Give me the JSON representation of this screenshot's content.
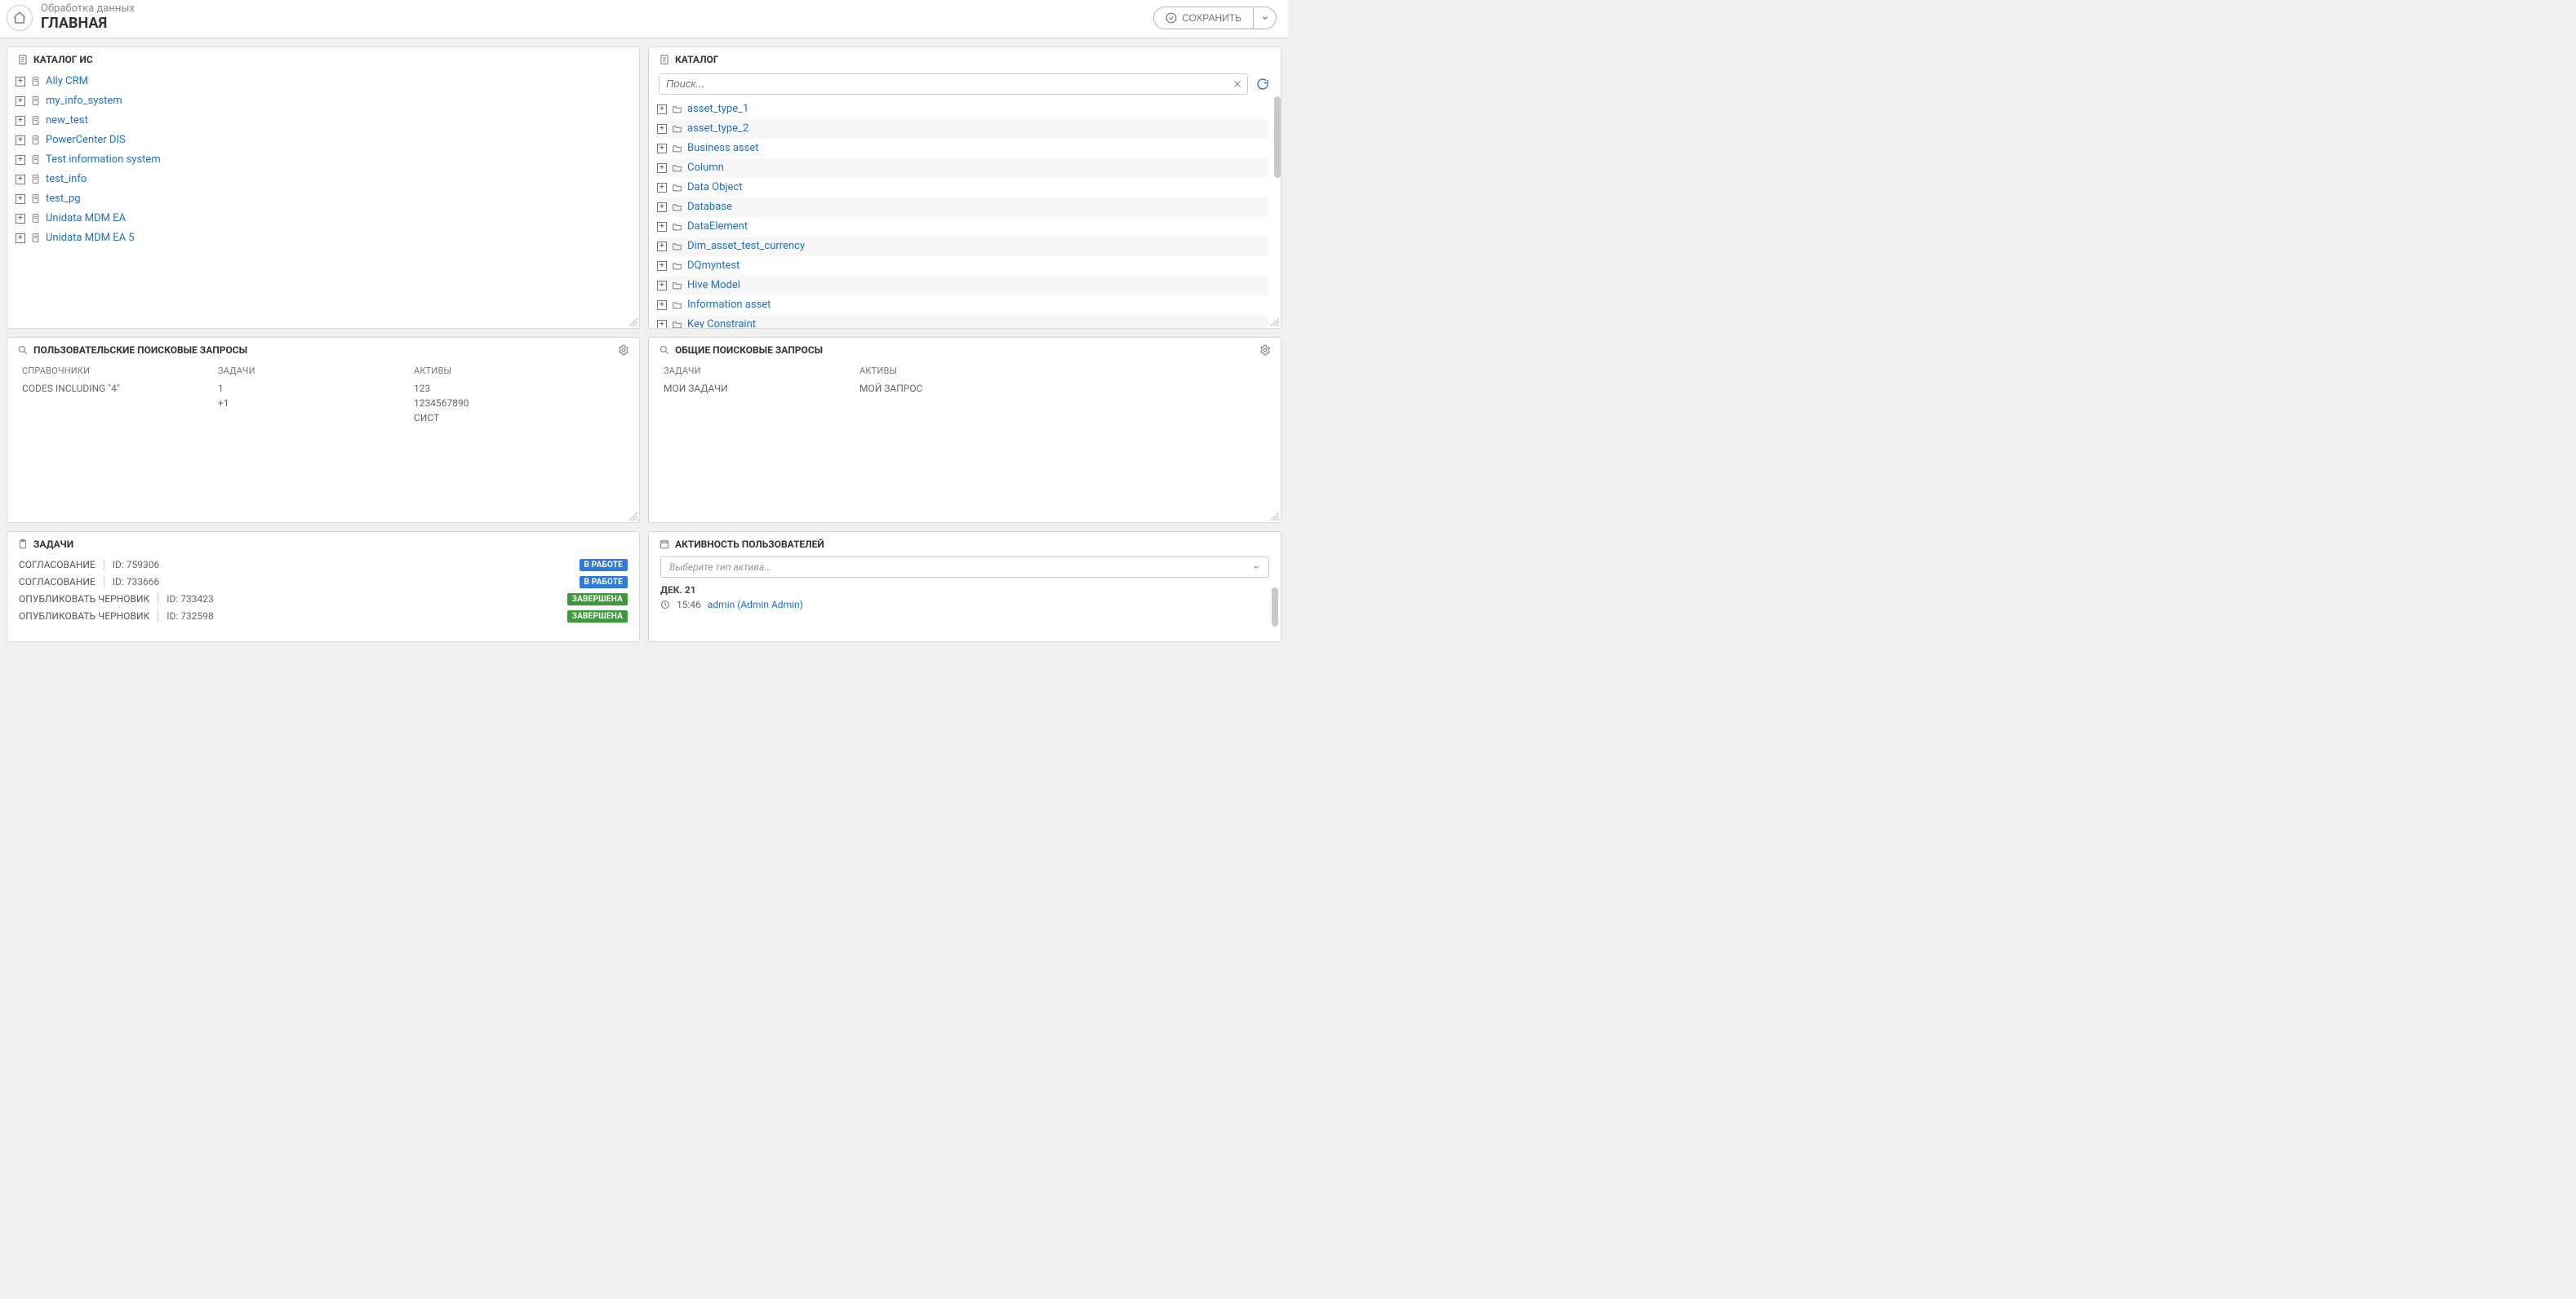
{
  "header": {
    "subtitle": "Обработка данных",
    "title": "ГЛАВНАЯ",
    "save_label": "СОХРАНИТЬ"
  },
  "catalog_is": {
    "title": "КАТАЛОГ ИС",
    "items": [
      {
        "label": "Ally CRM"
      },
      {
        "label": "my_info_system"
      },
      {
        "label": "new_test"
      },
      {
        "label": "PowerCenter DIS"
      },
      {
        "label": "Test information system"
      },
      {
        "label": "test_info"
      },
      {
        "label": "test_pg"
      },
      {
        "label": "Unidata MDM EA"
      },
      {
        "label": "Unidata MDM EA 5"
      }
    ]
  },
  "catalog": {
    "title": "КАТАЛОГ",
    "search_placeholder": "Поиск...",
    "items": [
      {
        "label": "asset_type_1"
      },
      {
        "label": "asset_type_2"
      },
      {
        "label": "Business asset"
      },
      {
        "label": "Column"
      },
      {
        "label": "Data Object"
      },
      {
        "label": "Database"
      },
      {
        "label": "DataElement"
      },
      {
        "label": "Dim_asset_test_currency"
      },
      {
        "label": "DQmyntest"
      },
      {
        "label": "Hive Model"
      },
      {
        "label": "Information asset"
      },
      {
        "label": "Key Constraint"
      }
    ]
  },
  "user_search": {
    "title": "ПОЛЬЗОВАТЕЛЬСКИЕ ПОИСКОВЫЕ ЗАПРОСЫ",
    "columns": {
      "col1": {
        "header": "СПРАВОЧНИКИ",
        "items": [
          "CODES INCLUDING \"4\""
        ]
      },
      "col2": {
        "header": "ЗАДАЧИ",
        "items": [
          "1",
          "+1"
        ]
      },
      "col3": {
        "header": "АКТИВЫ",
        "items": [
          "123",
          "1234567890",
          "СИСТ"
        ]
      }
    }
  },
  "shared_search": {
    "title": "ОБЩИЕ ПОИСКОВЫЕ ЗАПРОСЫ",
    "columns": {
      "col1": {
        "header": "ЗАДАЧИ",
        "items": [
          "МОИ ЗАДАЧИ"
        ]
      },
      "col2": {
        "header": "АКТИВЫ",
        "items": [
          "МОЙ ЗАПРОС"
        ]
      }
    }
  },
  "tasks": {
    "title": "ЗАДАЧИ",
    "rows": [
      {
        "type": "СОГЛАСОВАНИЕ",
        "id": "ID: 759306",
        "status_label": "В РАБОТЕ",
        "status_class": "st-work"
      },
      {
        "type": "СОГЛАСОВАНИЕ",
        "id": "ID: 733666",
        "status_label": "В РАБОТЕ",
        "status_class": "st-work"
      },
      {
        "type": "ОПУБЛИКОВАТЬ ЧЕРНОВИК",
        "id": "ID: 733423",
        "status_label": "ЗАВЕРШЕНА",
        "status_class": "st-done"
      },
      {
        "type": "ОПУБЛИКОВАТЬ ЧЕРНОВИК",
        "id": "ID: 732598",
        "status_label": "ЗАВЕРШЕНА",
        "status_class": "st-done"
      }
    ]
  },
  "activity": {
    "title": "АКТИВНОСТЬ ПОЛЬЗОВАТЕЛЕЙ",
    "select_placeholder": "Выберите тип актива...",
    "date_label": "ДЕК. 21",
    "entries": [
      {
        "time": "15:46",
        "user": "admin (Admin Admin)"
      }
    ]
  }
}
